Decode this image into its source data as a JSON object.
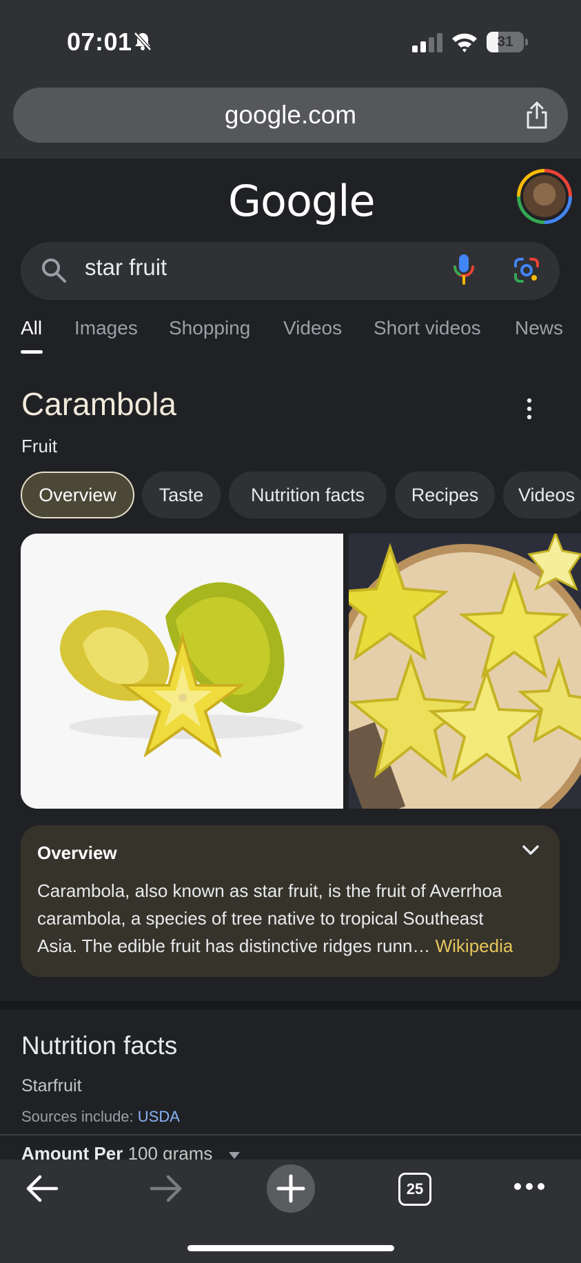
{
  "status_bar": {
    "time": "07:01",
    "battery": "31",
    "battery_level": 0.31
  },
  "browser": {
    "url": "google.com",
    "tab_count": "25"
  },
  "google": {
    "logo": "Google"
  },
  "search": {
    "query": "star fruit"
  },
  "nav_tabs": [
    "All",
    "Images",
    "Shopping",
    "Videos",
    "Short videos",
    "News"
  ],
  "knowledge_panel": {
    "title": "Carambola",
    "subtitle": "Fruit",
    "chips": [
      "Overview",
      "Taste",
      "Nutrition facts",
      "Recipes",
      "Videos"
    ],
    "overview": {
      "heading": "Overview",
      "lines": [
        "Carambola, also known as star fruit, is the fruit of Averrhoa",
        "carambola, a species of tree native to tropical Southeast",
        "Asia. The edible fruit has distinctive ridges runn"
      ],
      "ellipsis": "… ",
      "source_link": "Wikipedia"
    }
  },
  "nutrition": {
    "title": "Nutrition facts",
    "item": "Starfruit",
    "sources_label": "Sources include: ",
    "sources_link": "USDA",
    "amount_label": "Amount Per",
    "amount_value": " 100 grams"
  },
  "colors": {
    "page_bg": "#202124",
    "browser_chrome": "#2f3134",
    "overview_card": "#36332b",
    "accent_link": "#e6c65a",
    "usda_link": "#8ab4f8"
  },
  "icons": [
    "bell-slash-icon",
    "signal-icon",
    "wifi-icon",
    "share-icon",
    "search-icon",
    "mic-icon",
    "lens-icon",
    "more-vert-icon",
    "chevron-down-icon",
    "back-icon",
    "forward-icon",
    "plus-icon",
    "tabs-icon",
    "more-horiz-icon"
  ]
}
